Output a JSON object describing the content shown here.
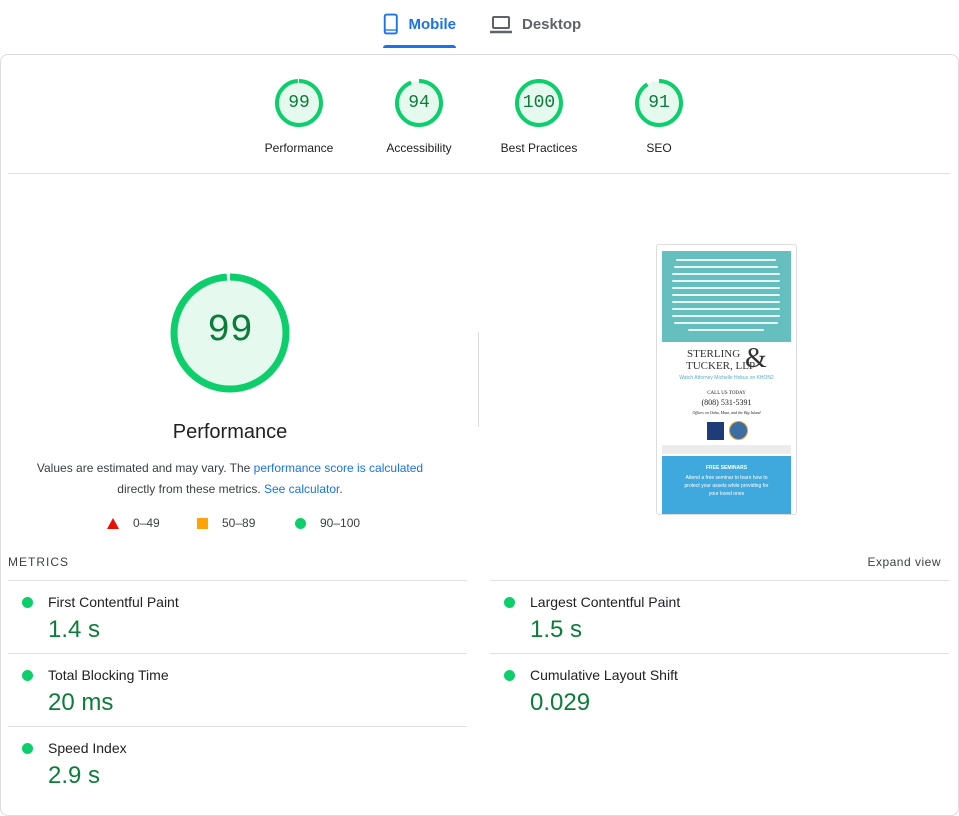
{
  "tabs": [
    {
      "label": "Mobile",
      "icon": "smartphone-icon",
      "active": true
    },
    {
      "label": "Desktop",
      "icon": "laptop-icon",
      "active": false
    }
  ],
  "gauges": [
    {
      "label": "Performance",
      "score": "99"
    },
    {
      "label": "Accessibility",
      "score": "94"
    },
    {
      "label": "Best Practices",
      "score": "100"
    },
    {
      "label": "SEO",
      "score": "91"
    }
  ],
  "performance": {
    "score": "99",
    "title": "Performance",
    "desc_prefix": "Values are estimated and may vary. The ",
    "desc_link1": "performance score is calculated",
    "desc_middle": " directly from these metrics. ",
    "desc_link2": "See calculator",
    "desc_suffix": "."
  },
  "legend": [
    {
      "range": "0–49",
      "shape": "triangle",
      "color": "#eb0f00"
    },
    {
      "range": "50–89",
      "shape": "square",
      "color": "#ffa400"
    },
    {
      "range": "90–100",
      "shape": "circle",
      "color": "#0cce6b"
    }
  ],
  "screenshot": {
    "firm_line1": "STERLING",
    "firm_line2": "TUCKER, LLP",
    "link_text": "Watch Attorney Michelle Hokus on KHON2",
    "call_label": "CALL US TODAY",
    "phone": "(808) 531-5391",
    "offices": "Offices on Oahu, Maui, and the Big Island",
    "seminar_title": "FREE SEMINARS",
    "seminar_text": "Attend a free seminar to learn how to protect your assets while providing for your loved ones"
  },
  "metrics": {
    "title": "METRICS",
    "expand_label": "Expand view",
    "items": [
      {
        "name": "First Contentful Paint",
        "value": "1.4 s"
      },
      {
        "name": "Largest Contentful Paint",
        "value": "1.5 s"
      },
      {
        "name": "Total Blocking Time",
        "value": "20 ms"
      },
      {
        "name": "Cumulative Layout Shift",
        "value": "0.029"
      },
      {
        "name": "Speed Index",
        "value": "2.9 s"
      }
    ]
  },
  "colors": {
    "accent": "#1a73e8",
    "pass": "#0cce6b",
    "pass_text": "#0c7c3b",
    "average": "#ffa400",
    "fail": "#eb0f00"
  }
}
